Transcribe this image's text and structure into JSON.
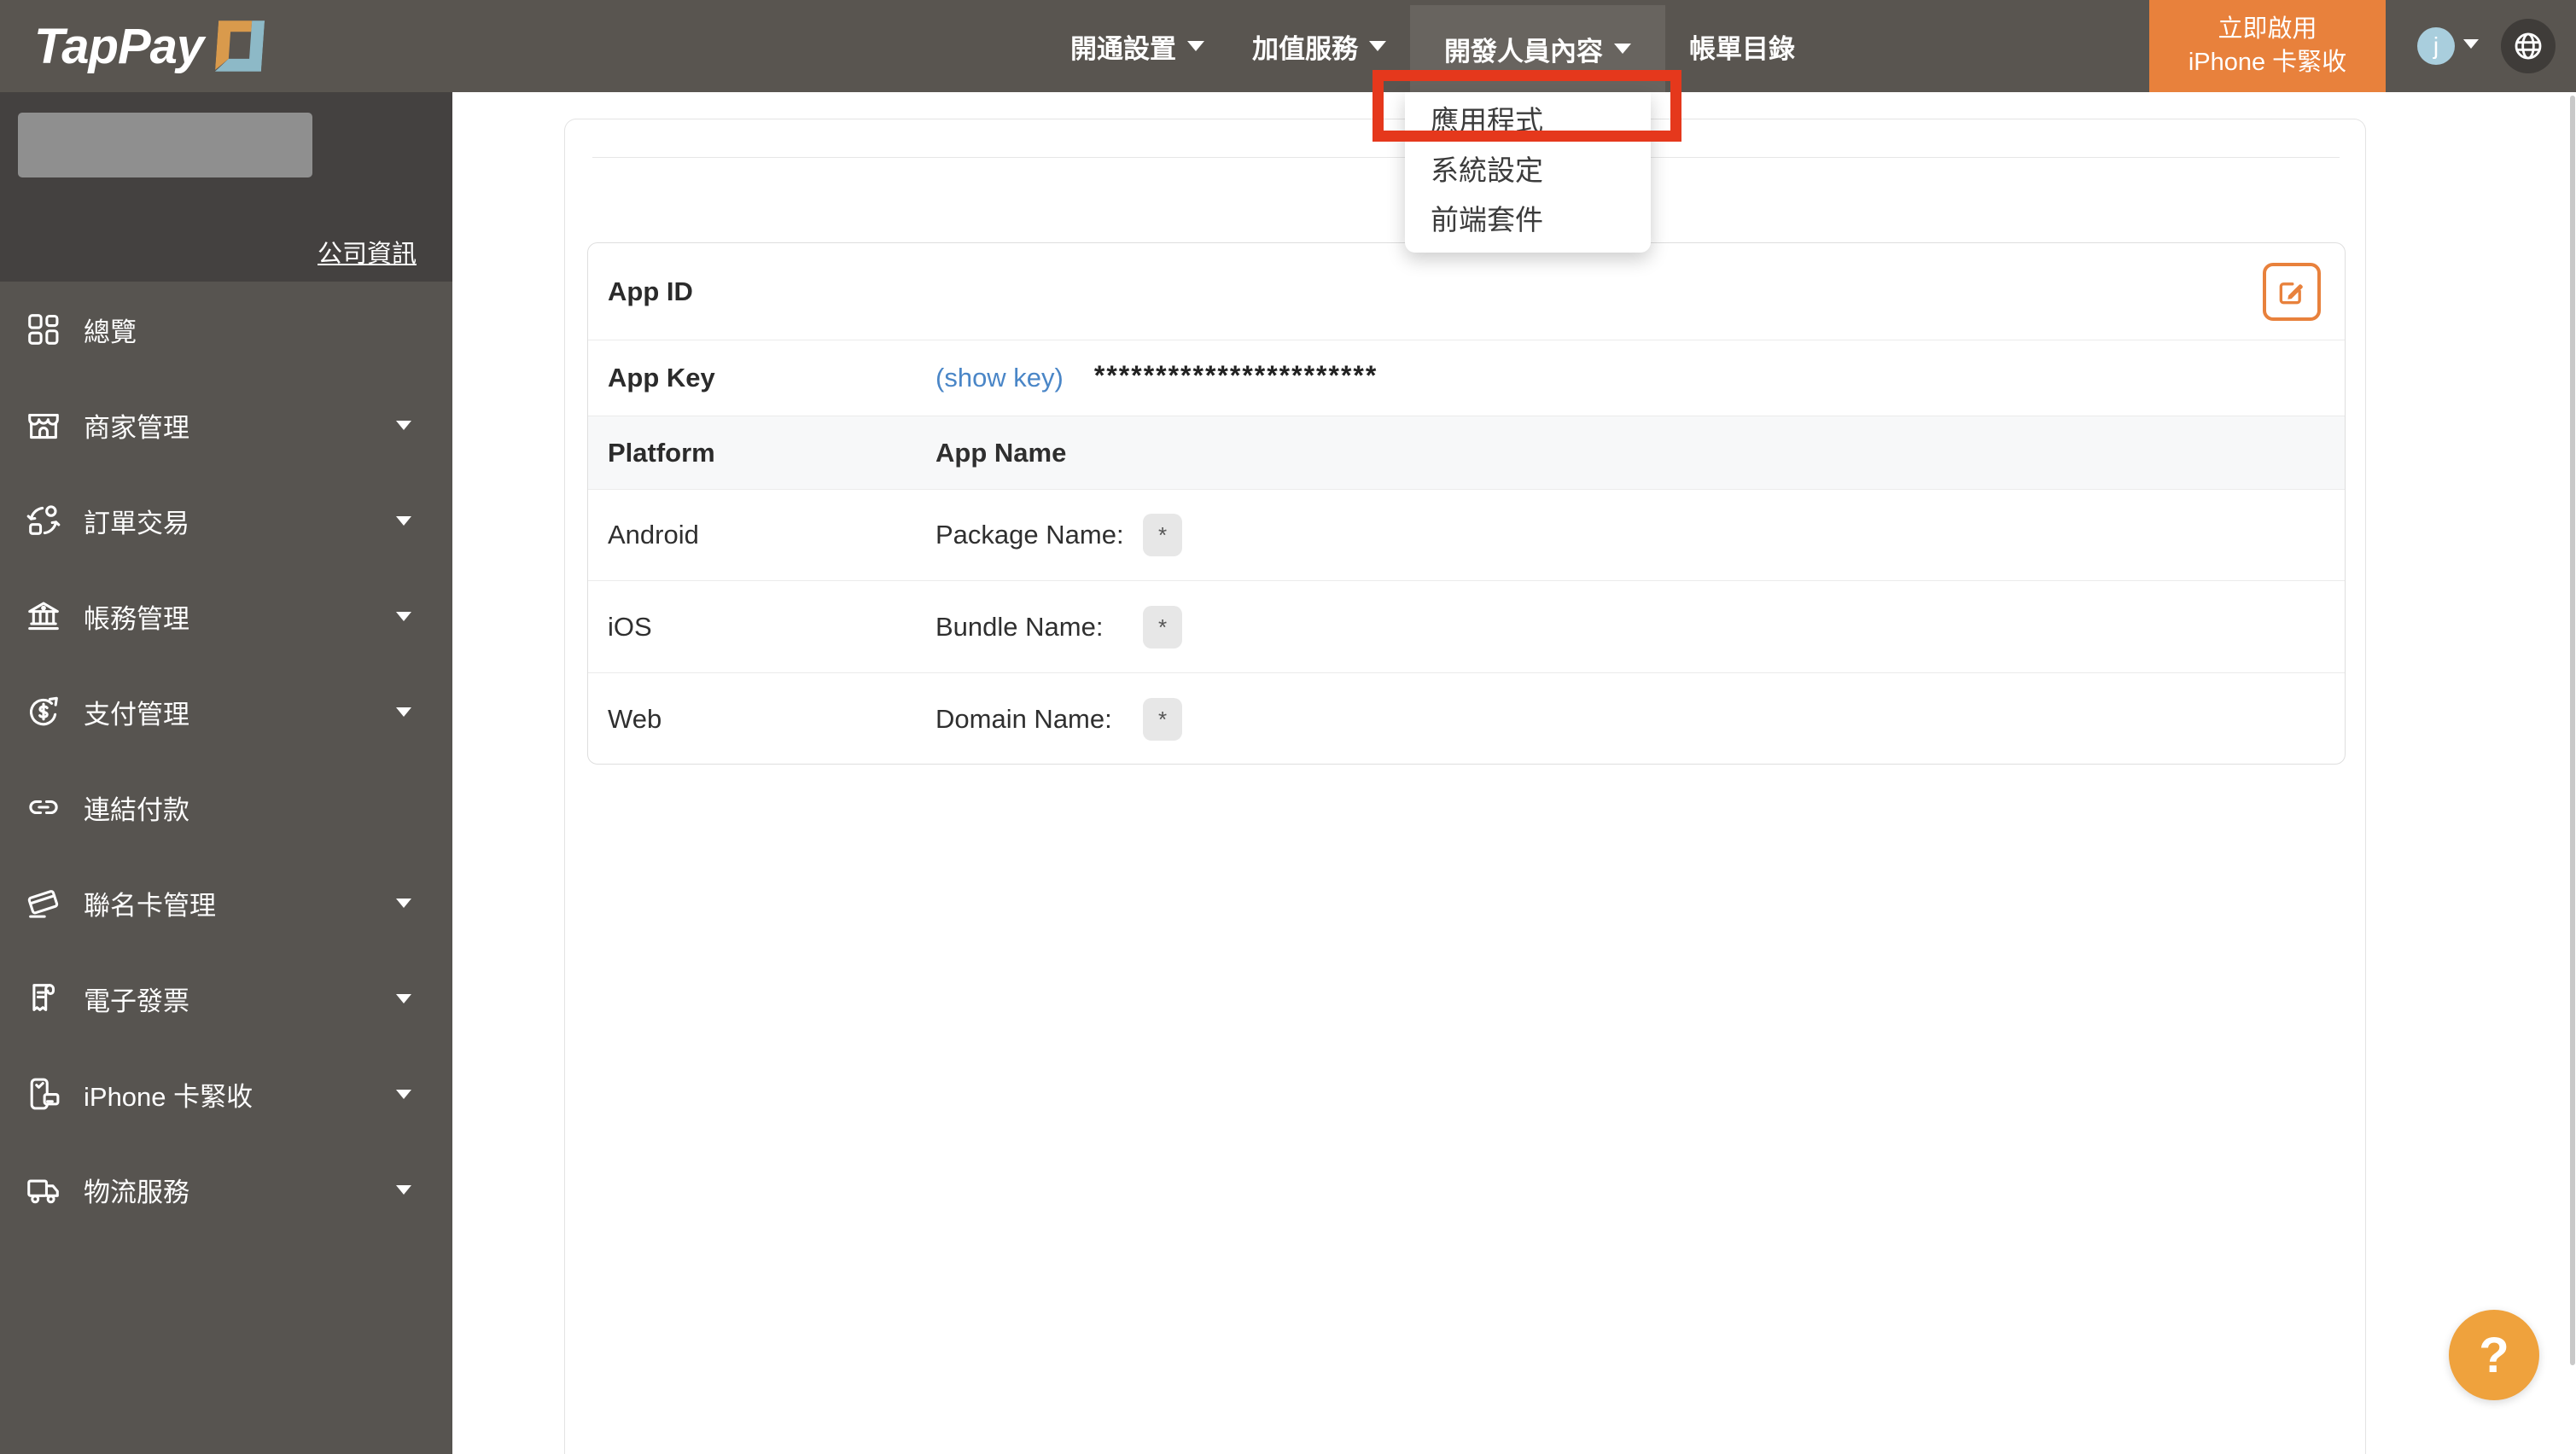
{
  "brand": {
    "logo_text": "TapPay"
  },
  "navbar": {
    "menu_items": [
      {
        "label": "開通設置",
        "caret": true,
        "active": false
      },
      {
        "label": "加值服務",
        "caret": true,
        "active": false
      },
      {
        "label": "開發人員內容",
        "caret": true,
        "active": true
      },
      {
        "label": "帳單目錄",
        "caret": false,
        "active": false
      }
    ],
    "cta_button": {
      "line1": "立即啟用",
      "line2": "iPhone 卡緊收"
    },
    "user_avatar_initial": "j"
  },
  "developer_dropdown": {
    "items": [
      "應用程式",
      "系統設定",
      "前端套件"
    ],
    "annotated_item": "應用程式"
  },
  "sidebar": {
    "company_info_link": "公司資訊",
    "menu_items": [
      {
        "label": "總覽",
        "icon": "overview-grid-icon",
        "caret": false
      },
      {
        "label": "商家管理",
        "icon": "storefront-icon",
        "caret": true
      },
      {
        "label": "訂單交易",
        "icon": "order-transactions-icon",
        "caret": true
      },
      {
        "label": "帳務管理",
        "icon": "bank-icon",
        "caret": true
      },
      {
        "label": "支付管理",
        "icon": "payment-cycle-icon",
        "caret": true
      },
      {
        "label": "連結付款",
        "icon": "payment-link-icon",
        "caret": false
      },
      {
        "label": "聯名卡管理",
        "icon": "cobranded-card-icon",
        "caret": true
      },
      {
        "label": "電子發票",
        "icon": "e-invoice-icon",
        "caret": true
      },
      {
        "label": "iPhone 卡緊收",
        "icon": "iphone-tap-to-pay-icon",
        "caret": true
      },
      {
        "label": "物流服務",
        "icon": "logistics-truck-icon",
        "caret": true
      }
    ]
  },
  "app_card": {
    "app_id_label": "App ID",
    "app_key_label": "App Key",
    "show_key_link": "(show key)",
    "masked_app_key": "***********************",
    "platform_header": "Platform",
    "app_name_header": "App Name",
    "rows": [
      {
        "platform": "Android",
        "field_label": "Package Name:",
        "value_badge": "*"
      },
      {
        "platform": "iOS",
        "field_label": "Bundle Name:",
        "value_badge": "*"
      },
      {
        "platform": "Web",
        "field_label": "Domain Name:",
        "value_badge": "*"
      }
    ]
  },
  "help_button_label": "?",
  "colors": {
    "navbar_bg": "#595550",
    "sidebar_top_bg": "#444140",
    "sidebar_menu_bg": "#575450",
    "accent_orange": "#e8813c",
    "help_orange": "#efa23d",
    "annotation_red": "#e5381c",
    "link_blue": "#4a86c7",
    "avatar_blue": "#a9cedd",
    "logo_orange": "#d99a4c",
    "logo_teal": "#8db9c7"
  }
}
